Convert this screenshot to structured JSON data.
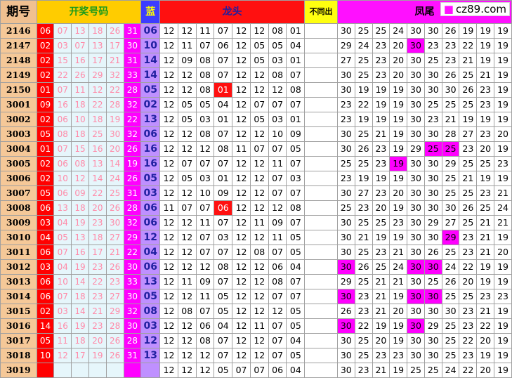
{
  "headers": {
    "period": "期号",
    "draw": "开奖号码",
    "blue": "蓝",
    "dragon": "龙头",
    "nosame": "不同出",
    "phoenix": "凤尾"
  },
  "logo": {
    "text": "cz89.com"
  },
  "rows": [
    {
      "p": "2146",
      "r": [
        "06",
        "07",
        "13",
        "18",
        "26",
        "31"
      ],
      "b": "06",
      "d": [
        "12",
        "12",
        "11",
        "07",
        "12",
        "12",
        "08",
        "01"
      ],
      "f": [
        "30",
        "25",
        "25",
        "24",
        "30",
        "30",
        "26",
        "19",
        "19",
        "19"
      ],
      "dh": [],
      "fh": []
    },
    {
      "p": "2147",
      "r": [
        "02",
        "03",
        "07",
        "13",
        "17",
        "30"
      ],
      "b": "10",
      "d": [
        "12",
        "11",
        "07",
        "06",
        "12",
        "05",
        "05",
        "04"
      ],
      "f": [
        "29",
        "24",
        "23",
        "20",
        "30",
        "23",
        "23",
        "22",
        "19",
        "19"
      ],
      "dh": [],
      "fh": [
        4
      ]
    },
    {
      "p": "2148",
      "r": [
        "02",
        "15",
        "16",
        "17",
        "21",
        "31"
      ],
      "b": "14",
      "d": [
        "12",
        "09",
        "08",
        "07",
        "12",
        "05",
        "03",
        "01"
      ],
      "f": [
        "27",
        "25",
        "23",
        "20",
        "30",
        "25",
        "23",
        "21",
        "19",
        "19"
      ],
      "dh": [],
      "fh": []
    },
    {
      "p": "2149",
      "r": [
        "02",
        "22",
        "26",
        "29",
        "32",
        "33"
      ],
      "b": "14",
      "d": [
        "12",
        "12",
        "08",
        "07",
        "12",
        "12",
        "08",
        "07"
      ],
      "f": [
        "30",
        "25",
        "23",
        "20",
        "30",
        "30",
        "26",
        "25",
        "21",
        "19"
      ],
      "dh": [],
      "fh": []
    },
    {
      "p": "2150",
      "r": [
        "01",
        "07",
        "11",
        "12",
        "22",
        "28"
      ],
      "b": "05",
      "d": [
        "12",
        "12",
        "08",
        "01",
        "12",
        "12",
        "12",
        "08"
      ],
      "f": [
        "30",
        "19",
        "19",
        "19",
        "30",
        "30",
        "30",
        "26",
        "23",
        "19"
      ],
      "dh": [
        3
      ],
      "fh": []
    },
    {
      "p": "3001",
      "r": [
        "09",
        "16",
        "18",
        "22",
        "28",
        "32"
      ],
      "b": "02",
      "d": [
        "12",
        "05",
        "05",
        "04",
        "12",
        "07",
        "07",
        "07"
      ],
      "f": [
        "23",
        "22",
        "19",
        "19",
        "30",
        "25",
        "25",
        "25",
        "23",
        "19"
      ],
      "dh": [],
      "fh": []
    },
    {
      "p": "3002",
      "r": [
        "02",
        "06",
        "10",
        "18",
        "19",
        "22"
      ],
      "b": "13",
      "d": [
        "12",
        "05",
        "03",
        "01",
        "12",
        "05",
        "03",
        "01"
      ],
      "f": [
        "23",
        "19",
        "19",
        "19",
        "30",
        "23",
        "21",
        "19",
        "19",
        "19"
      ],
      "dh": [],
      "fh": []
    },
    {
      "p": "3003",
      "r": [
        "05",
        "08",
        "18",
        "25",
        "30",
        "32"
      ],
      "b": "06",
      "d": [
        "12",
        "12",
        "08",
        "07",
        "12",
        "12",
        "10",
        "09"
      ],
      "f": [
        "30",
        "25",
        "21",
        "19",
        "30",
        "30",
        "28",
        "27",
        "23",
        "20"
      ],
      "dh": [],
      "fh": []
    },
    {
      "p": "3004",
      "r": [
        "01",
        "07",
        "15",
        "16",
        "20",
        "26"
      ],
      "b": "16",
      "d": [
        "12",
        "12",
        "12",
        "08",
        "11",
        "07",
        "07",
        "05"
      ],
      "f": [
        "30",
        "26",
        "23",
        "19",
        "29",
        "25",
        "25",
        "23",
        "20",
        "19"
      ],
      "dh": [],
      "fh": [
        5,
        6
      ]
    },
    {
      "p": "3005",
      "r": [
        "02",
        "06",
        "08",
        "13",
        "14",
        "19"
      ],
      "b": "16",
      "d": [
        "12",
        "07",
        "07",
        "07",
        "12",
        "12",
        "11",
        "07"
      ],
      "f": [
        "25",
        "25",
        "23",
        "19",
        "30",
        "30",
        "29",
        "25",
        "25",
        "23"
      ],
      "dh": [],
      "fh": [
        3
      ]
    },
    {
      "p": "3006",
      "r": [
        "02",
        "10",
        "12",
        "14",
        "24",
        "26"
      ],
      "b": "05",
      "d": [
        "12",
        "05",
        "03",
        "01",
        "12",
        "12",
        "07",
        "03"
      ],
      "f": [
        "23",
        "19",
        "19",
        "19",
        "30",
        "30",
        "25",
        "21",
        "19",
        "19"
      ],
      "dh": [],
      "fh": []
    },
    {
      "p": "3007",
      "r": [
        "05",
        "06",
        "09",
        "22",
        "25",
        "31"
      ],
      "b": "03",
      "d": [
        "12",
        "12",
        "10",
        "09",
        "12",
        "12",
        "07",
        "07"
      ],
      "f": [
        "30",
        "27",
        "23",
        "20",
        "30",
        "30",
        "25",
        "25",
        "23",
        "21"
      ],
      "dh": [],
      "fh": []
    },
    {
      "p": "3008",
      "r": [
        "06",
        "13",
        "18",
        "20",
        "26",
        "28"
      ],
      "b": "06",
      "d": [
        "11",
        "07",
        "07",
        "06",
        "12",
        "12",
        "12",
        "08"
      ],
      "f": [
        "25",
        "23",
        "20",
        "19",
        "30",
        "30",
        "30",
        "26",
        "25",
        "24"
      ],
      "dh": [
        3
      ],
      "fh": []
    },
    {
      "p": "3009",
      "r": [
        "03",
        "04",
        "19",
        "23",
        "30",
        "32"
      ],
      "b": "06",
      "d": [
        "12",
        "12",
        "11",
        "07",
        "12",
        "11",
        "09",
        "07"
      ],
      "f": [
        "30",
        "25",
        "25",
        "23",
        "30",
        "29",
        "27",
        "25",
        "21",
        "21"
      ],
      "dh": [],
      "fh": []
    },
    {
      "p": "3010",
      "r": [
        "04",
        "05",
        "13",
        "18",
        "27",
        "29"
      ],
      "b": "12",
      "d": [
        "12",
        "12",
        "07",
        "03",
        "12",
        "12",
        "11",
        "05"
      ],
      "f": [
        "30",
        "21",
        "19",
        "19",
        "30",
        "30",
        "29",
        "23",
        "21",
        "19"
      ],
      "dh": [],
      "fh": [
        6
      ]
    },
    {
      "p": "3011",
      "r": [
        "06",
        "07",
        "16",
        "17",
        "21",
        "22"
      ],
      "b": "04",
      "d": [
        "12",
        "12",
        "07",
        "07",
        "12",
        "08",
        "07",
        "05"
      ],
      "f": [
        "30",
        "25",
        "23",
        "21",
        "30",
        "26",
        "25",
        "23",
        "21",
        "20"
      ],
      "dh": [],
      "fh": []
    },
    {
      "p": "3012",
      "r": [
        "03",
        "04",
        "19",
        "23",
        "26",
        "30"
      ],
      "b": "06",
      "d": [
        "12",
        "12",
        "12",
        "08",
        "12",
        "12",
        "06",
        "04"
      ],
      "f": [
        "30",
        "26",
        "25",
        "24",
        "30",
        "30",
        "24",
        "22",
        "19",
        "19"
      ],
      "dh": [],
      "fh": [
        0,
        4,
        5
      ]
    },
    {
      "p": "3013",
      "r": [
        "06",
        "10",
        "14",
        "22",
        "23",
        "33"
      ],
      "b": "13",
      "d": [
        "12",
        "11",
        "09",
        "07",
        "12",
        "12",
        "08",
        "07"
      ],
      "f": [
        "29",
        "25",
        "21",
        "21",
        "30",
        "25",
        "26",
        "20",
        "19",
        "19"
      ],
      "dh": [],
      "fh": []
    },
    {
      "p": "3014",
      "r": [
        "06",
        "07",
        "18",
        "23",
        "27",
        "30"
      ],
      "b": "05",
      "d": [
        "12",
        "12",
        "11",
        "05",
        "12",
        "12",
        "07",
        "07"
      ],
      "f": [
        "30",
        "23",
        "21",
        "19",
        "30",
        "30",
        "25",
        "25",
        "23",
        "23"
      ],
      "dh": [],
      "fh": [
        0,
        4,
        5
      ]
    },
    {
      "p": "3015",
      "r": [
        "02",
        "03",
        "14",
        "21",
        "29",
        "32"
      ],
      "b": "08",
      "d": [
        "12",
        "08",
        "07",
        "05",
        "12",
        "12",
        "12",
        "05"
      ],
      "f": [
        "26",
        "23",
        "21",
        "20",
        "30",
        "30",
        "30",
        "23",
        "21",
        "19"
      ],
      "dh": [],
      "fh": []
    },
    {
      "p": "3016",
      "r": [
        "14",
        "16",
        "19",
        "23",
        "28",
        "30"
      ],
      "b": "03",
      "d": [
        "12",
        "12",
        "06",
        "04",
        "12",
        "11",
        "07",
        "05"
      ],
      "f": [
        "30",
        "22",
        "19",
        "19",
        "30",
        "29",
        "25",
        "23",
        "22",
        "19"
      ],
      "dh": [],
      "fh": [
        0,
        4
      ]
    },
    {
      "p": "3017",
      "r": [
        "05",
        "11",
        "18",
        "20",
        "26",
        "28"
      ],
      "b": "12",
      "d": [
        "12",
        "12",
        "08",
        "07",
        "12",
        "12",
        "07",
        "04"
      ],
      "f": [
        "30",
        "25",
        "20",
        "19",
        "30",
        "30",
        "25",
        "22",
        "20",
        "19"
      ],
      "dh": [],
      "fh": []
    },
    {
      "p": "3018",
      "r": [
        "10",
        "12",
        "17",
        "19",
        "26",
        "31"
      ],
      "b": "13",
      "d": [
        "12",
        "12",
        "12",
        "07",
        "12",
        "12",
        "07",
        "05"
      ],
      "f": [
        "30",
        "25",
        "23",
        "23",
        "30",
        "30",
        "25",
        "23",
        "19",
        "19"
      ],
      "dh": [],
      "fh": []
    },
    {
      "p": "3019",
      "r": [
        "",
        "",
        "",
        "",
        "",
        ""
      ],
      "b": "",
      "d": [
        "12",
        "12",
        "12",
        "05",
        "07",
        "07",
        "06",
        "04"
      ],
      "f": [
        "30",
        "23",
        "21",
        "19",
        "25",
        "25",
        "24",
        "22",
        "20",
        "19"
      ],
      "dh": [],
      "fh": []
    }
  ]
}
